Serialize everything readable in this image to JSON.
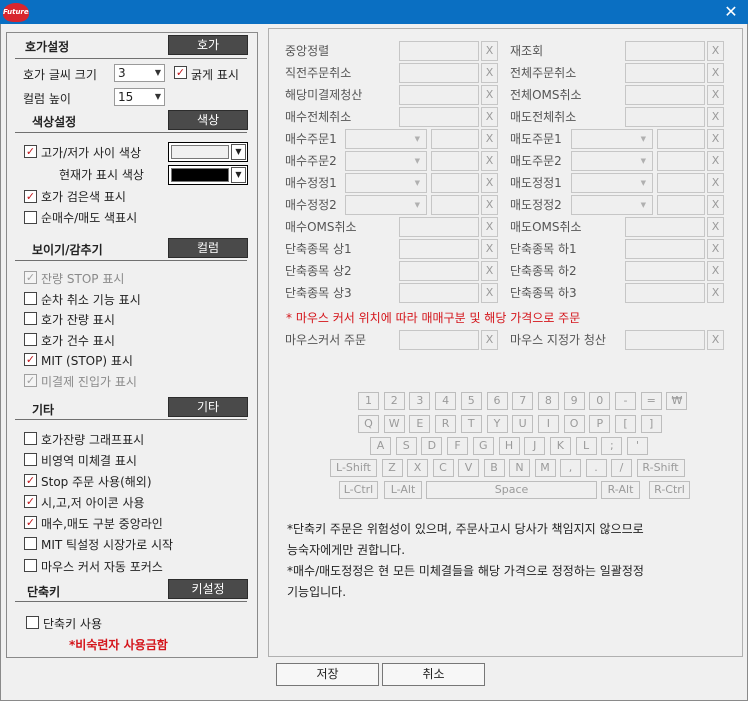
{
  "titlebar": {
    "logo_text": "Futures",
    "icon_close": "close-icon"
  },
  "left": {
    "hoga_settings": {
      "title": "호가설정",
      "button": "호가",
      "font_size_label": "호가 글씨 크기",
      "font_size_value": "3",
      "bold_label": "굵게 표시",
      "bold_checked": true,
      "col_height_label": "컬럼 높이",
      "col_height_value": "15"
    },
    "color_settings": {
      "title": "색상설정",
      "button": "색상",
      "between_color_label": "고가/저가 사이 색상",
      "between_color_checked": true,
      "between_color_value": "#f0f0f0",
      "current_color_label": "현재가 표시 색상",
      "current_color_value": "#000000",
      "black_hoga_label": "호가 검은색 표시",
      "black_hoga_checked": true,
      "net_color_label": "순매수/매도 색표시",
      "net_color_checked": false
    },
    "show_hide": {
      "title": "보이기/감추기",
      "button": "컬럼",
      "items": [
        {
          "label": "잔량 STOP 표시",
          "checked": true,
          "disabled": true
        },
        {
          "label": "순차 취소 기능 표시",
          "checked": false,
          "disabled": false
        },
        {
          "label": "호가 잔량 표시",
          "checked": false,
          "disabled": false
        },
        {
          "label": "호가 건수 표시",
          "checked": false,
          "disabled": false
        },
        {
          "label": "MIT (STOP) 표시",
          "checked": true,
          "disabled": false
        },
        {
          "label": "미결제 진입가 표시",
          "checked": true,
          "disabled": true
        }
      ]
    },
    "etc": {
      "title": "기타",
      "button": "기타",
      "items": [
        {
          "label": "호가잔량 그래프표시",
          "checked": false
        },
        {
          "label": "비영역 미체결 표시",
          "checked": false
        },
        {
          "label": "Stop 주문 사용(해외)",
          "checked": true
        },
        {
          "label": "시,고,저 아이콘 사용",
          "checked": true
        },
        {
          "label": "매수,매도 구분 중앙라인",
          "checked": true
        },
        {
          "label": "MIT 틱설정 시장가로 시작",
          "checked": false
        },
        {
          "label": "마우스 커서 자동 포커스",
          "checked": false
        }
      ]
    },
    "shortcut": {
      "title": "단축키",
      "button": "키설정",
      "use_label": "단축키 사용",
      "use_checked": false,
      "warning": "*비숙련자 사용금함"
    }
  },
  "right": {
    "rows_a": [
      {
        "left": "중앙정렬",
        "right": "재조회"
      },
      {
        "left": "직전주문취소",
        "right": "전체주문취소"
      },
      {
        "left": "해당미결제청산",
        "right": "전체OMS취소"
      },
      {
        "left": "매수전체취소",
        "right": "매도전체취소"
      }
    ],
    "rows_b": [
      {
        "left": "매수주문1",
        "right": "매도주문1"
      },
      {
        "left": "매수주문2",
        "right": "매도주문2"
      },
      {
        "left": "매수정정1",
        "right": "매도정정1"
      },
      {
        "left": "매수정정2",
        "right": "매도정정2"
      }
    ],
    "rows_c": [
      {
        "left": "매수OMS취소",
        "right": "매도OMS취소"
      },
      {
        "left": "단축종목 상1",
        "right": "단축종목 하1"
      },
      {
        "left": "단축종목 상2",
        "right": "단축종목 하2"
      },
      {
        "left": "단축종목 상3",
        "right": "단축종목 하3"
      }
    ],
    "x_label": "X",
    "mouse_note": "* 마우스 커서 위치에 따라 매매구분 및 해당 가격으로 주문",
    "mouse_order_label": "마우스커서 주문",
    "mouse_clear_label": "마우스 지정가 청산",
    "keyboard": {
      "row1": [
        "1",
        "2",
        "3",
        "4",
        "5",
        "6",
        "7",
        "8",
        "9",
        "0",
        "-",
        "=",
        "₩"
      ],
      "row2": [
        "Q",
        "W",
        "E",
        "R",
        "T",
        "Y",
        "U",
        "I",
        "O",
        "P",
        "[",
        "]"
      ],
      "row3": [
        "A",
        "S",
        "D",
        "F",
        "G",
        "H",
        "J",
        "K",
        "L",
        ";",
        "'"
      ],
      "row4": [
        "L-Shift",
        "Z",
        "X",
        "C",
        "V",
        "B",
        "N",
        "M",
        ",",
        ".",
        "/",
        "R-Shift"
      ],
      "row5": [
        "L-Ctrl",
        "L-Alt",
        "Space",
        "R-Alt",
        "R-Ctrl"
      ]
    },
    "notes": [
      "*단축키 주문은 위험성이 있으며, 주문사고시 당사가 책임지지 않으므로",
      "능숙자에게만 권합니다.",
      "*매수/매도정정은 현 모든 미체결들을 해당 가격으로 정정하는 일괄정정",
      "기능입니다."
    ]
  },
  "buttons": {
    "save": "저장",
    "cancel": "취소"
  }
}
